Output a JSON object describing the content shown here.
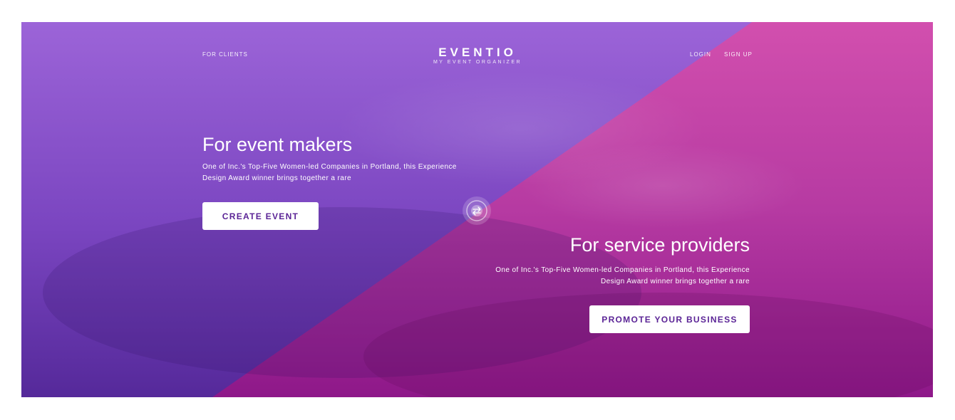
{
  "nav": {
    "left_link": "FOR CLIENTS",
    "login": "LOGIN",
    "signup": "SIGN UP"
  },
  "logo": {
    "name": "EVENTIO",
    "tagline": "MY EVENT ORGANIZER"
  },
  "left_panel": {
    "title": "For event makers",
    "description": "One of Inc.'s Top-Five Women-led Companies in Portland, this Experience Design Award winner brings together a rare",
    "button_label": "CREATE EVENT"
  },
  "right_panel": {
    "title": "For service providers",
    "description": "One of Inc.'s Top-Five Women-led Companies in Portland, this Experience Design Award winner brings together a rare",
    "button_label": "PROMOTE YOUR BUSINESS"
  },
  "colors": {
    "left_top": "#9a63d6",
    "left_bottom": "#5a2c9e",
    "right_top": "#d04aa8",
    "right_bottom": "#8f1a8a",
    "button_text": "#5b2496"
  },
  "icons": {
    "center": "swap-icon"
  }
}
